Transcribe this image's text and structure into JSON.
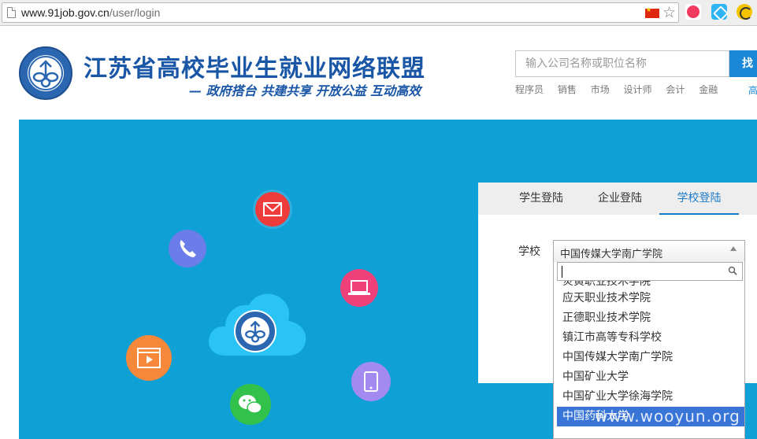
{
  "browser": {
    "url_domain": "www.91job.gov.cn",
    "url_path": "/user/login"
  },
  "header": {
    "site_title": "江苏省高校毕业生就业网络联盟",
    "slogan": "— 政府搭台 共建共享 开放公益 互动高效",
    "search_placeholder": "输入公司名称或职位名称",
    "search_button": "找工",
    "hot_links": [
      "程序员",
      "销售",
      "市场",
      "设计师",
      "会计",
      "金融"
    ],
    "hot_more": "高"
  },
  "login": {
    "tabs": {
      "student": "学生登陆",
      "company": "企业登陆",
      "school": "学校登陆"
    },
    "active_tab": "school",
    "school_label": "学校",
    "school_selected": "中国传媒大学南广学院",
    "filter_value": "",
    "options": [
      "炎黄职业技术学院",
      "应天职业技术学院",
      "正德职业技术学院",
      "镇江市高等专科学校",
      "中国传媒大学南广学院",
      "中国矿业大学",
      "中国矿业大学徐海学院",
      "中国药科大学"
    ],
    "highlighted_option": "中国药科大学"
  },
  "watermark": "www.wooyun.org",
  "colors": {
    "banner": "#0fa0d6",
    "brand_blue": "#1a56a6",
    "tab_active": "#1a7ac8",
    "highlight": "#3875d7"
  }
}
